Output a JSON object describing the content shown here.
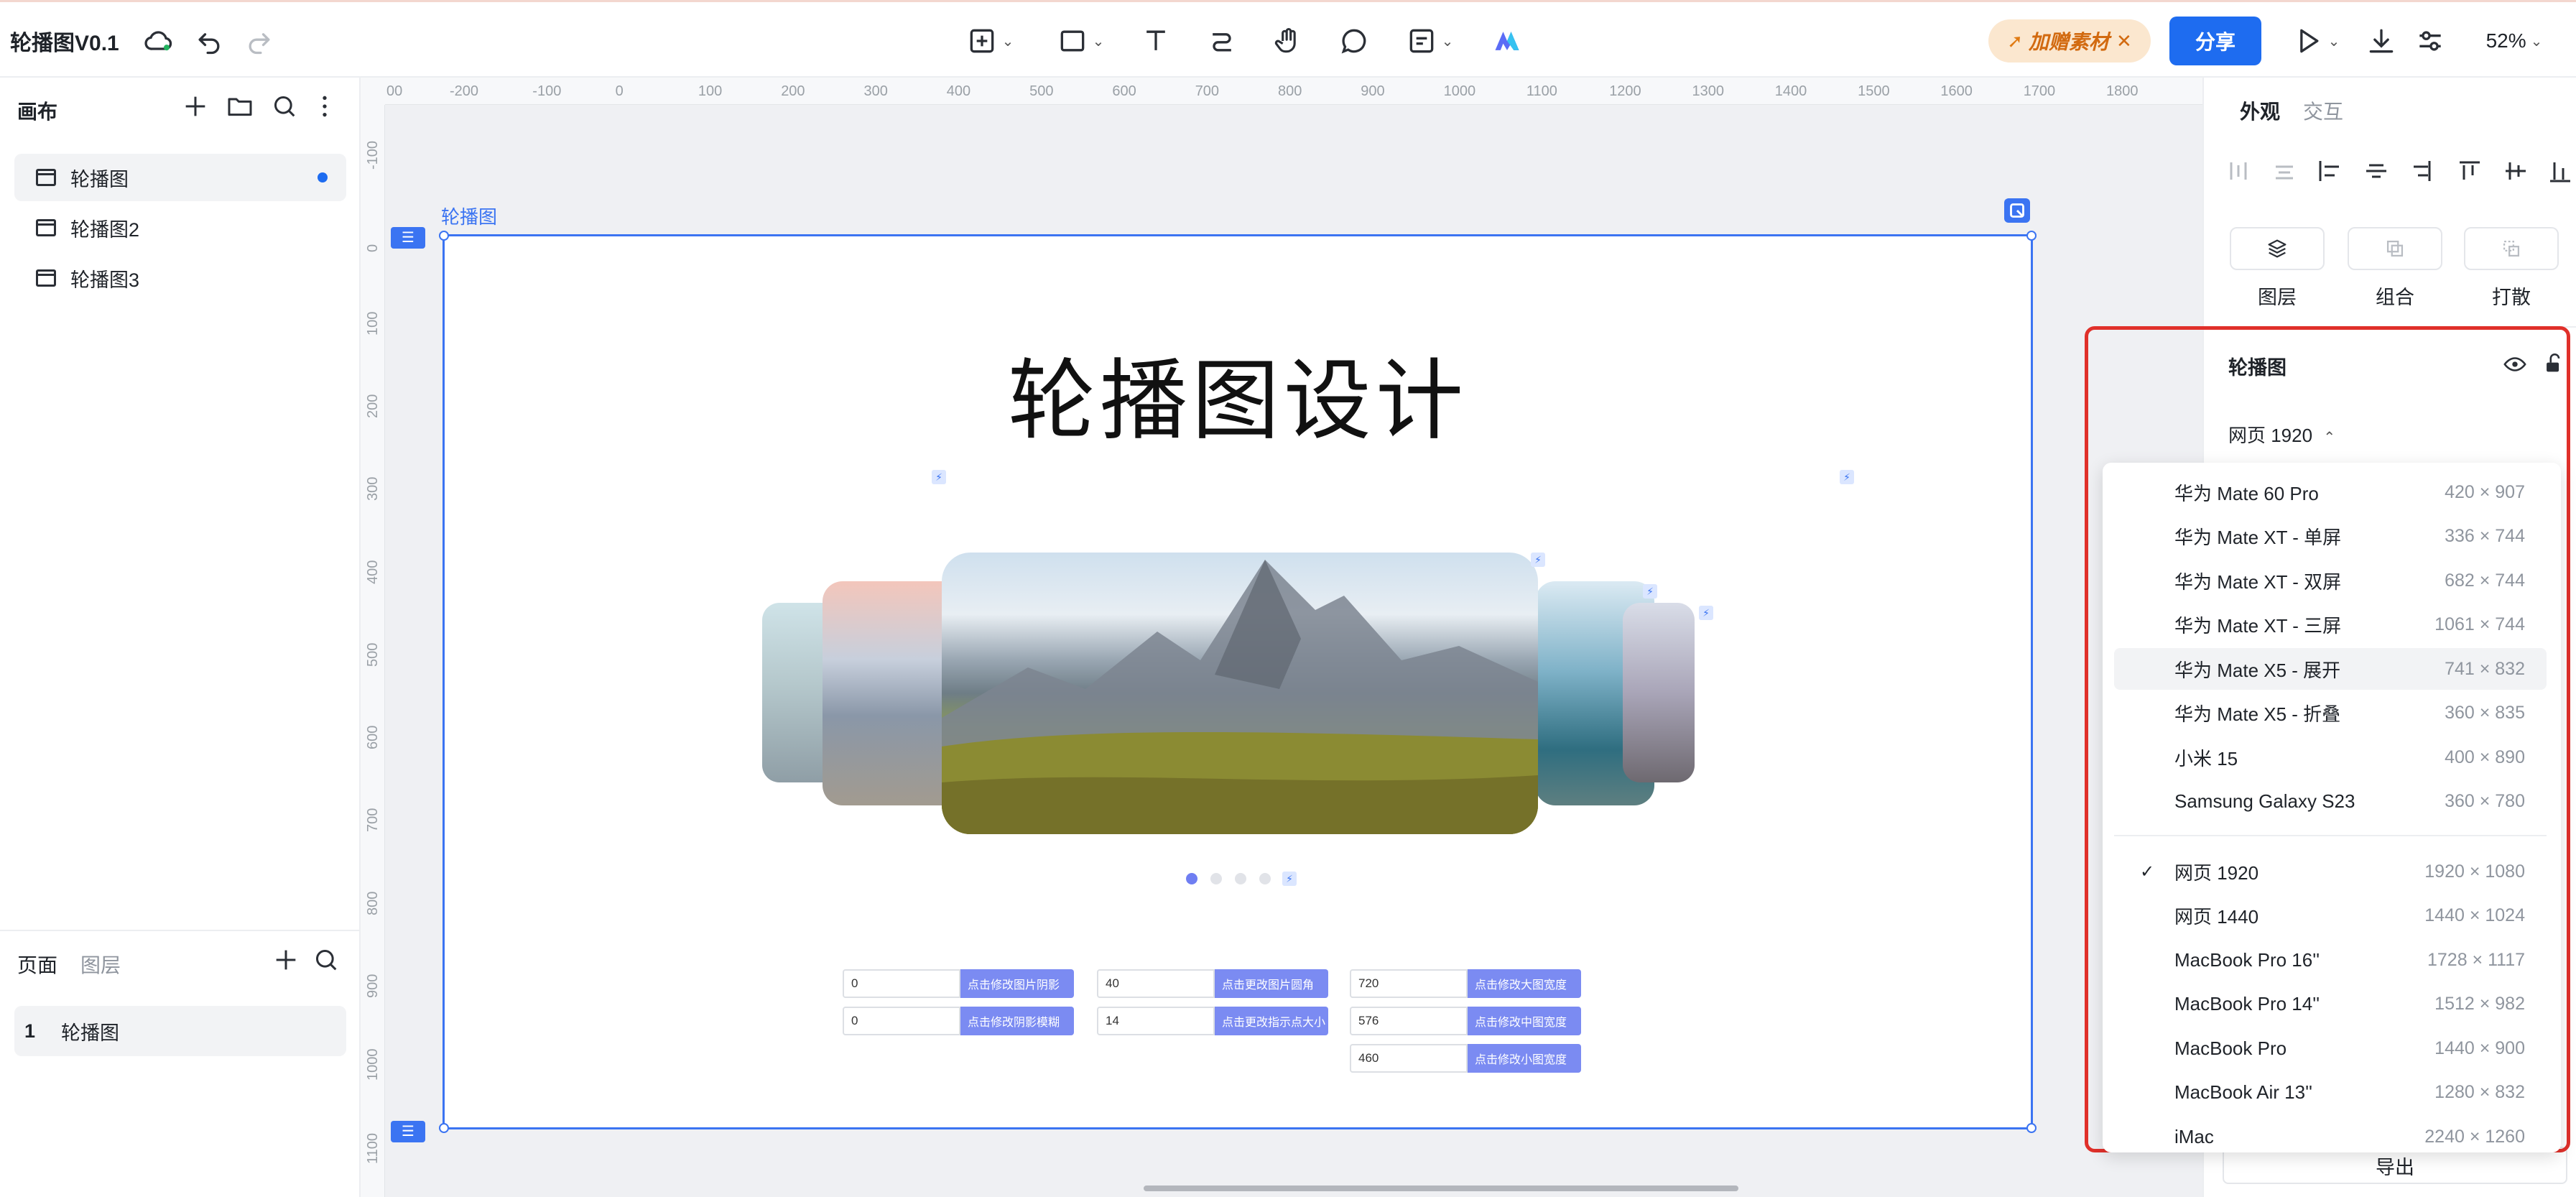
{
  "app": {
    "title": "轮播图V0.1",
    "zoom": "52%",
    "promo_label": "加赠素材",
    "share_label": "分享"
  },
  "left_panel": {
    "canvas_title": "画布",
    "pages": [
      {
        "label": "轮播图",
        "active": true
      },
      {
        "label": "轮播图2",
        "active": false
      },
      {
        "label": "轮播图3",
        "active": false
      }
    ],
    "bottom_tabs": {
      "pages": "页面",
      "layers": "图层"
    },
    "page_list": [
      {
        "index": "1",
        "label": "轮播图"
      }
    ]
  },
  "ruler": {
    "top_ticks": [
      "00",
      "-200",
      "-100",
      "0",
      "100",
      "200",
      "300",
      "400",
      "500",
      "600",
      "700",
      "800",
      "900",
      "1000",
      "1100",
      "1200",
      "1300",
      "1400",
      "1500",
      "1600",
      "1700",
      "1800"
    ],
    "left_ticks": [
      "-100",
      "0",
      "100",
      "200",
      "300",
      "400",
      "500",
      "600",
      "700",
      "800",
      "900",
      "1000",
      "1100"
    ]
  },
  "artboard": {
    "name": "轮播图",
    "heading": "轮播图设计",
    "controls": [
      {
        "value": "0",
        "label": "点击修改图片阴影"
      },
      {
        "value": "0",
        "label": "点击修改阴影模糊"
      },
      {
        "value": "40",
        "label": "点击更改图片圆角"
      },
      {
        "value": "14",
        "label": "点击更改指示点大小"
      },
      {
        "value": "720",
        "label": "点击修改大图宽度"
      },
      {
        "value": "576",
        "label": "点击修改中图宽度"
      },
      {
        "value": "460",
        "label": "点击修改小图宽度"
      }
    ],
    "indicator_count": 4,
    "active_indicator": 0
  },
  "right_panel": {
    "tabs": {
      "appearance": "外观",
      "interaction": "交互"
    },
    "actions": {
      "layer": "图层",
      "group": "组合",
      "ungroup": "打散"
    },
    "element_name": "轮播图",
    "preset_current": "网页 1920",
    "export_label": "导出"
  },
  "presets": {
    "mobile": [
      {
        "name": "华为 Mate 60 Pro",
        "size": "420 × 907"
      },
      {
        "name": "华为 Mate XT - 单屏",
        "size": "336 × 744"
      },
      {
        "name": "华为 Mate XT - 双屏",
        "size": "682 × 744"
      },
      {
        "name": "华为 Mate XT - 三屏",
        "size": "1061 × 744"
      },
      {
        "name": "华为 Mate X5 - 展开",
        "size": "741 × 832"
      },
      {
        "name": "华为 Mate X5 - 折叠",
        "size": "360 × 835"
      },
      {
        "name": "小米 15",
        "size": "400 × 890"
      },
      {
        "name": "Samsung Galaxy S23",
        "size": "360 × 780"
      }
    ],
    "desktop": [
      {
        "name": "网页 1920",
        "size": "1920 × 1080",
        "checked": true
      },
      {
        "name": "网页 1440",
        "size": "1440 × 1024"
      },
      {
        "name": "MacBook Pro 16''",
        "size": "1728 × 1117"
      },
      {
        "name": "MacBook Pro 14''",
        "size": "1512 × 982"
      },
      {
        "name": "MacBook Pro",
        "size": "1440 × 900"
      },
      {
        "name": "MacBook Air 13''",
        "size": "1280 × 832"
      },
      {
        "name": "iMac",
        "size": "2240 × 1260"
      }
    ],
    "hovered": "华为 Mate X5 - 展开"
  },
  "colors": {
    "accent": "#1e6cf0",
    "selection": "#3b74f2",
    "highlight_border": "#e0302a",
    "promo_bg": "#fbe7cf",
    "control_button": "#7b8bf2"
  },
  "icons": [
    "cloud-sync-icon",
    "undo-icon",
    "redo-icon",
    "add-frame-icon",
    "rectangle-icon",
    "text-icon",
    "connector-icon",
    "hand-icon",
    "comment-icon",
    "note-icon",
    "ai-logo-icon",
    "play-icon",
    "download-icon",
    "settings-sliders-icon",
    "plus-icon",
    "folder-icon",
    "search-icon",
    "more-icon",
    "eye-icon",
    "unlock-icon",
    "check-icon",
    "bolt-icon"
  ]
}
